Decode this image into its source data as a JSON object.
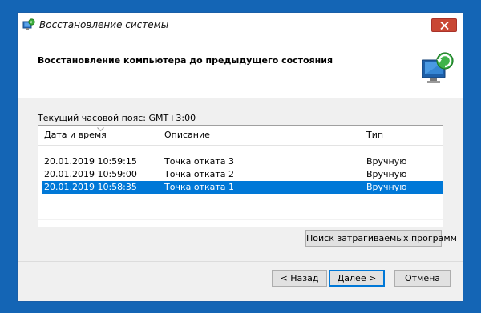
{
  "window": {
    "title": "Восстановление системы",
    "heading": "Восстановление компьютера до предыдущего состояния"
  },
  "timezone_label": "Текущий часовой пояс: GMT+3:00",
  "table": {
    "columns": [
      "Дата и время",
      "Описание",
      "Тип"
    ],
    "rows": [
      {
        "date": "20.01.2019 10:59:15",
        "description": "Точка отката 3",
        "type": "Вручную",
        "selected": false
      },
      {
        "date": "20.01.2019 10:59:00",
        "description": "Точка отката 2",
        "type": "Вручную",
        "selected": false
      },
      {
        "date": "20.01.2019 10:58:35",
        "description": "Точка отката 1",
        "type": "Вручную",
        "selected": true
      }
    ]
  },
  "buttons": {
    "scan": "Поиск затрагиваемых программ",
    "back": "< Назад",
    "next": "Далее >",
    "cancel": "Отмена"
  },
  "colors": {
    "desktop": "#1465b5",
    "selection": "#0078d7",
    "close_button": "#c94734"
  },
  "icons": [
    "system-restore-icon",
    "close-icon",
    "sort-arrow-icon"
  ]
}
